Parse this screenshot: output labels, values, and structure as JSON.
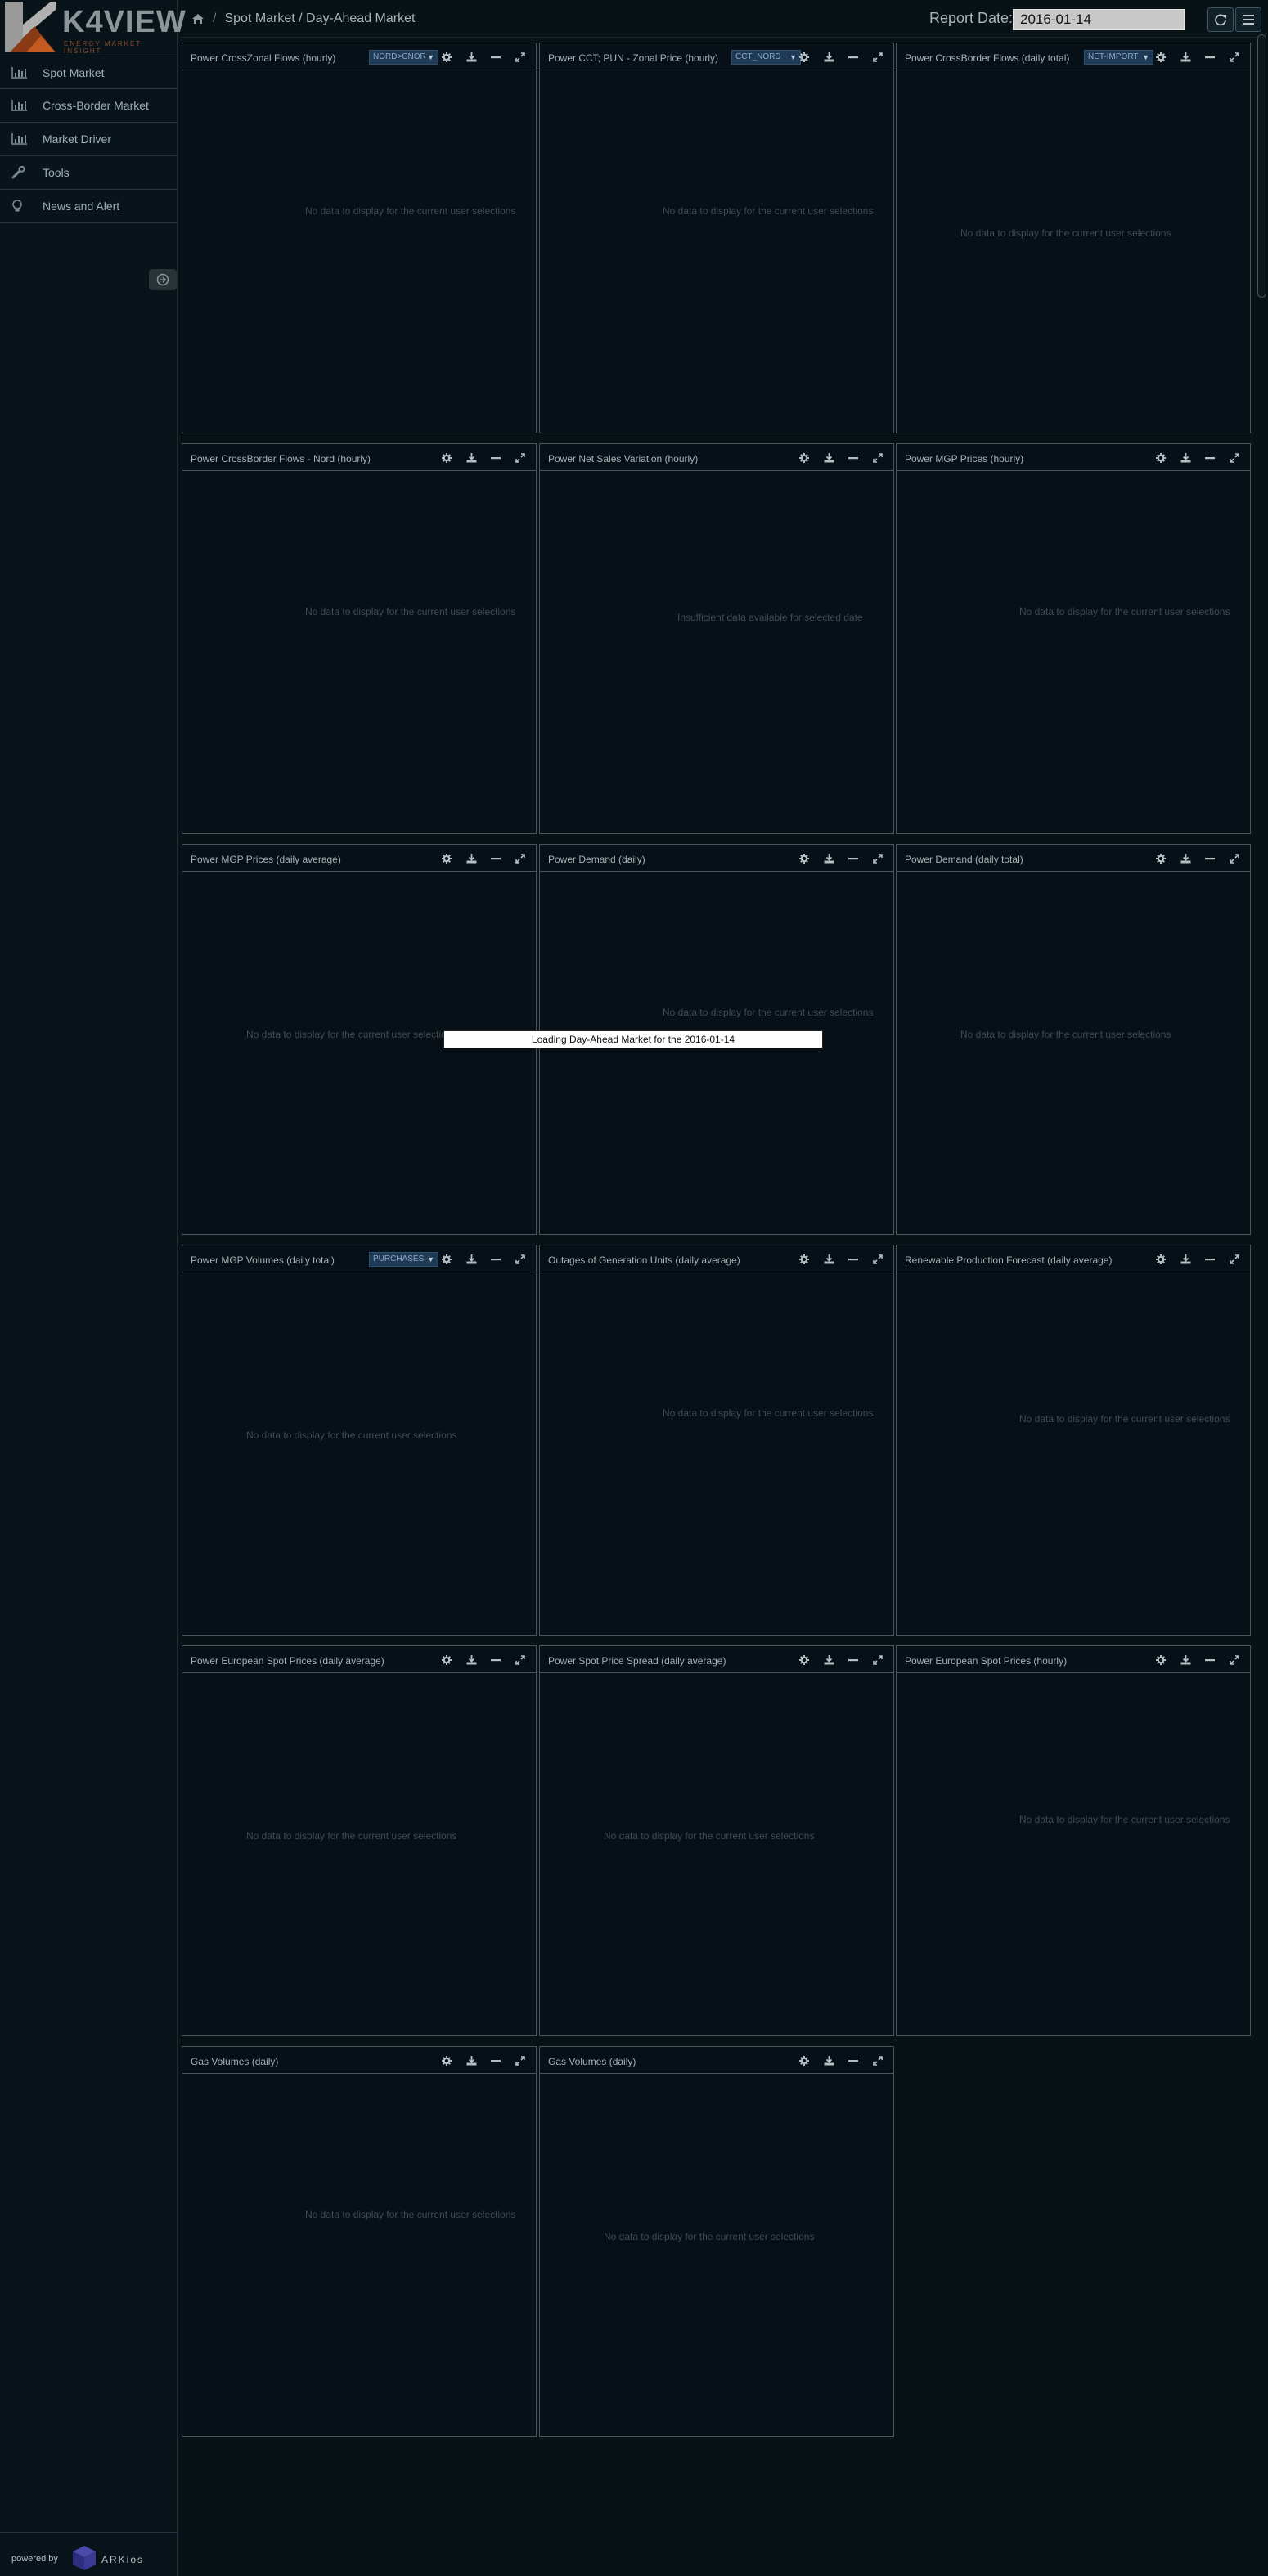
{
  "brand": {
    "logo_text": "K4VIEW",
    "logo_sub": "ENERGY MARKET INSIGHT",
    "powered_by": "powered by",
    "partner": "ARKios"
  },
  "sidebar": {
    "items": [
      {
        "label": "Spot Market",
        "icon": "bar-chart-icon"
      },
      {
        "label": "Cross-Border Market",
        "icon": "bar-chart-icon"
      },
      {
        "label": "Market Driver",
        "icon": "bar-chart-icon"
      },
      {
        "label": "Tools",
        "icon": "wrench-icon"
      },
      {
        "label": "News and Alert",
        "icon": "lightbulb-icon"
      }
    ]
  },
  "header": {
    "breadcrumb": [
      "Spot Market / Day-Ahead Market"
    ],
    "report_label": "Report Date:",
    "report_date": "2016-01-14"
  },
  "loading_text": "Loading Day-Ahead Market for the 2016-01-14",
  "widgets": [
    {
      "title": "Power CrossZonal Flows (hourly)",
      "select": "NORD>CNOR",
      "message": "No data to display for the current user selections"
    },
    {
      "title": "Power CCT; PUN - Zonal Price (hourly)",
      "select": "CCT_NORD",
      "message": "No data to display for the current user selections"
    },
    {
      "title": "Power CrossBorder Flows (daily total)",
      "select": "NET-IMPORT",
      "message": "No data to display for the current user selections"
    },
    {
      "title": "Power CrossBorder Flows - Nord (hourly)",
      "select": "",
      "message": "No data to display for the current user selections"
    },
    {
      "title": "Power Net Sales Variation (hourly)",
      "select": "",
      "message": "Insufficient data available for selected date"
    },
    {
      "title": "Power MGP Prices (hourly)",
      "select": "",
      "message": "No data to display for the current user selections"
    },
    {
      "title": "Power MGP Prices (daily average)",
      "select": "",
      "message": "No data to display for the current user selections"
    },
    {
      "title": "Power Demand (daily)",
      "select": "",
      "message": "No data to display for the current user selections"
    },
    {
      "title": "Power Demand (daily total)",
      "select": "",
      "message": "No data to display for the current user selections"
    },
    {
      "title": "Power MGP Volumes (daily total)",
      "select": "PURCHASES",
      "message": "No data to display for the current user selections"
    },
    {
      "title": "Outages of Generation Units (daily average)",
      "select": "",
      "message": "No data to display for the current user selections"
    },
    {
      "title": "Renewable Production Forecast (daily average)",
      "select": "",
      "message": "No data to display for the current user selections"
    },
    {
      "title": "Power European Spot Prices (daily average)",
      "select": "",
      "message": "No data to display for the current user selections"
    },
    {
      "title": "Power Spot Price Spread (daily average)",
      "select": "",
      "message": "No data to display for the current user selections"
    },
    {
      "title": "Power European Spot Prices (hourly)",
      "select": "",
      "message": "No data to display for the current user selections"
    },
    {
      "title": "Gas Volumes (daily)",
      "select": "",
      "message": "No data to display for the current user selections"
    },
    {
      "title": "Gas Volumes (daily)",
      "select": "",
      "message": "No data to display for the current user selections"
    }
  ]
}
